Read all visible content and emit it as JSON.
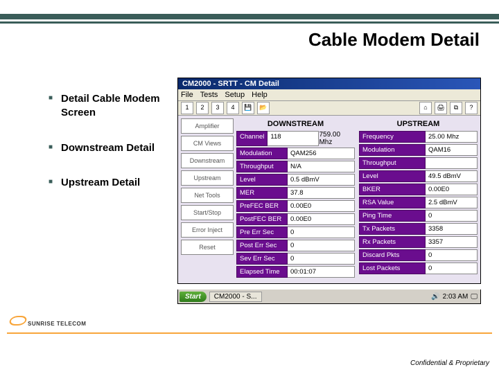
{
  "slide": {
    "title": "Cable Modem Detail",
    "bullets": [
      "Detail Cable Modem Screen",
      "Downstream Detail",
      "Upstream Detail"
    ],
    "brand": "SUNRISE TELECOM",
    "confidential": "Confidential & Proprietary"
  },
  "app": {
    "window_title": "CM2000 - SRTT - CM Detail",
    "menus": [
      "File",
      "Tests",
      "Setup",
      "Help"
    ],
    "toolbar_icons": [
      "pg1",
      "pg2",
      "pg3",
      "pg4",
      "save",
      "open",
      "print",
      "home",
      "printer2",
      "copy",
      "help"
    ],
    "sidebar": [
      "Amplifier",
      "CM Views",
      "Downstream",
      "Upstream",
      "Net Tools",
      "Start/Stop",
      "Error Inject",
      "Reset"
    ],
    "downstream": {
      "heading": "DOWNSTREAM",
      "rows": [
        {
          "label": "Channel",
          "value": "118",
          "value2": "759.00 Mhz"
        },
        {
          "label": "Modulation",
          "value": "QAM256"
        },
        {
          "label": "Throughput",
          "value": "N/A"
        },
        {
          "label": "Level",
          "value": "0.5 dBmV"
        },
        {
          "label": "MER",
          "value": "37.8"
        },
        {
          "label": "PreFEC BER",
          "value": "0.00E0"
        },
        {
          "label": "PostFEC BER",
          "value": "0.00E0"
        },
        {
          "label": "Pre Err Sec",
          "value": "0"
        },
        {
          "label": "Post Err Sec",
          "value": "0"
        },
        {
          "label": "Sev Err Sec",
          "value": "0"
        },
        {
          "label": "Elapsed Time",
          "value": "00:01:07"
        }
      ]
    },
    "upstream": {
      "heading": "UPSTREAM",
      "rows": [
        {
          "label": "Frequency",
          "value": "25.00 Mhz"
        },
        {
          "label": "Modulation",
          "value": "QAM16"
        },
        {
          "label": "Throughput",
          "value": ""
        },
        {
          "label": "Level",
          "value": "49.5 dBmV"
        },
        {
          "label": "BKER",
          "value": "0.00E0"
        },
        {
          "label": "RSA Value",
          "value": "2.5 dBmV"
        },
        {
          "label": "Ping Time",
          "value": "0"
        },
        {
          "label": "Tx Packets",
          "value": "3358"
        },
        {
          "label": "Rx Packets",
          "value": "3357"
        },
        {
          "label": "Discard Pkts",
          "value": "0"
        },
        {
          "label": "Lost Packets",
          "value": "0"
        }
      ]
    },
    "taskbar": {
      "start": "Start",
      "task": "CM2000 - S...",
      "clock": "2:03 AM"
    }
  }
}
